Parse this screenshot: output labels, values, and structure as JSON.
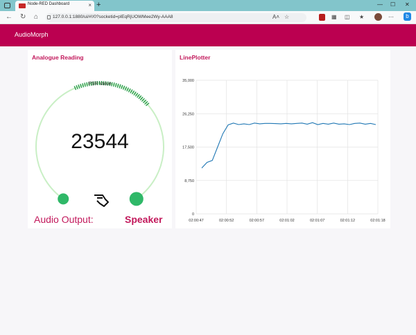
{
  "browser": {
    "tab_title": "Node-RED Dashboard",
    "url": "127.0.0.1:1880/ui/#!/0?socketid=plEqRjUOWMee2Wy-AAA8",
    "zoom_badge": "A",
    "reader_badge": "A˄",
    "window_minimize": "—",
    "window_maximize": "☐",
    "window_close": "✕",
    "new_tab": "+",
    "tab_close": "×"
  },
  "dashboard": {
    "title": "AudioMorph"
  },
  "analogue": {
    "card_title": "Analogue Reading",
    "gauge_label": "FSR Value",
    "gauge_value": "23544",
    "gauge_level": 0.67,
    "audio_label": "Audio Output:",
    "audio_value": "Speaker",
    "colors": {
      "arc": "#c9efc5",
      "fill": "#2e9e4f",
      "knob": "#2fb868"
    }
  },
  "plotter": {
    "card_title": "LinePlotter"
  },
  "chart_data": {
    "type": "line",
    "title": "",
    "xlabel": "",
    "ylabel": "",
    "ylim": [
      0,
      35000
    ],
    "yticks": [
      "35,000",
      "26,250",
      "17,500",
      "8,750",
      "0"
    ],
    "xticks": [
      "02:00:47",
      "02:00:52",
      "02:00:57",
      "02:01:02",
      "02:01:07",
      "02:01:12",
      "02:01:18"
    ],
    "series_color": "#1f77b4",
    "series": [
      {
        "values": [
          12000,
          13500,
          14000,
          17500,
          21000,
          23300,
          23800,
          23400,
          23600,
          23400,
          23800,
          23600,
          23700,
          23700,
          23650,
          23600,
          23700,
          23600,
          23700,
          23800,
          23500,
          23900,
          23400,
          23700,
          23500,
          23800,
          23500,
          23600,
          23400,
          23700,
          23800,
          23500,
          23700,
          23400
        ]
      }
    ]
  }
}
